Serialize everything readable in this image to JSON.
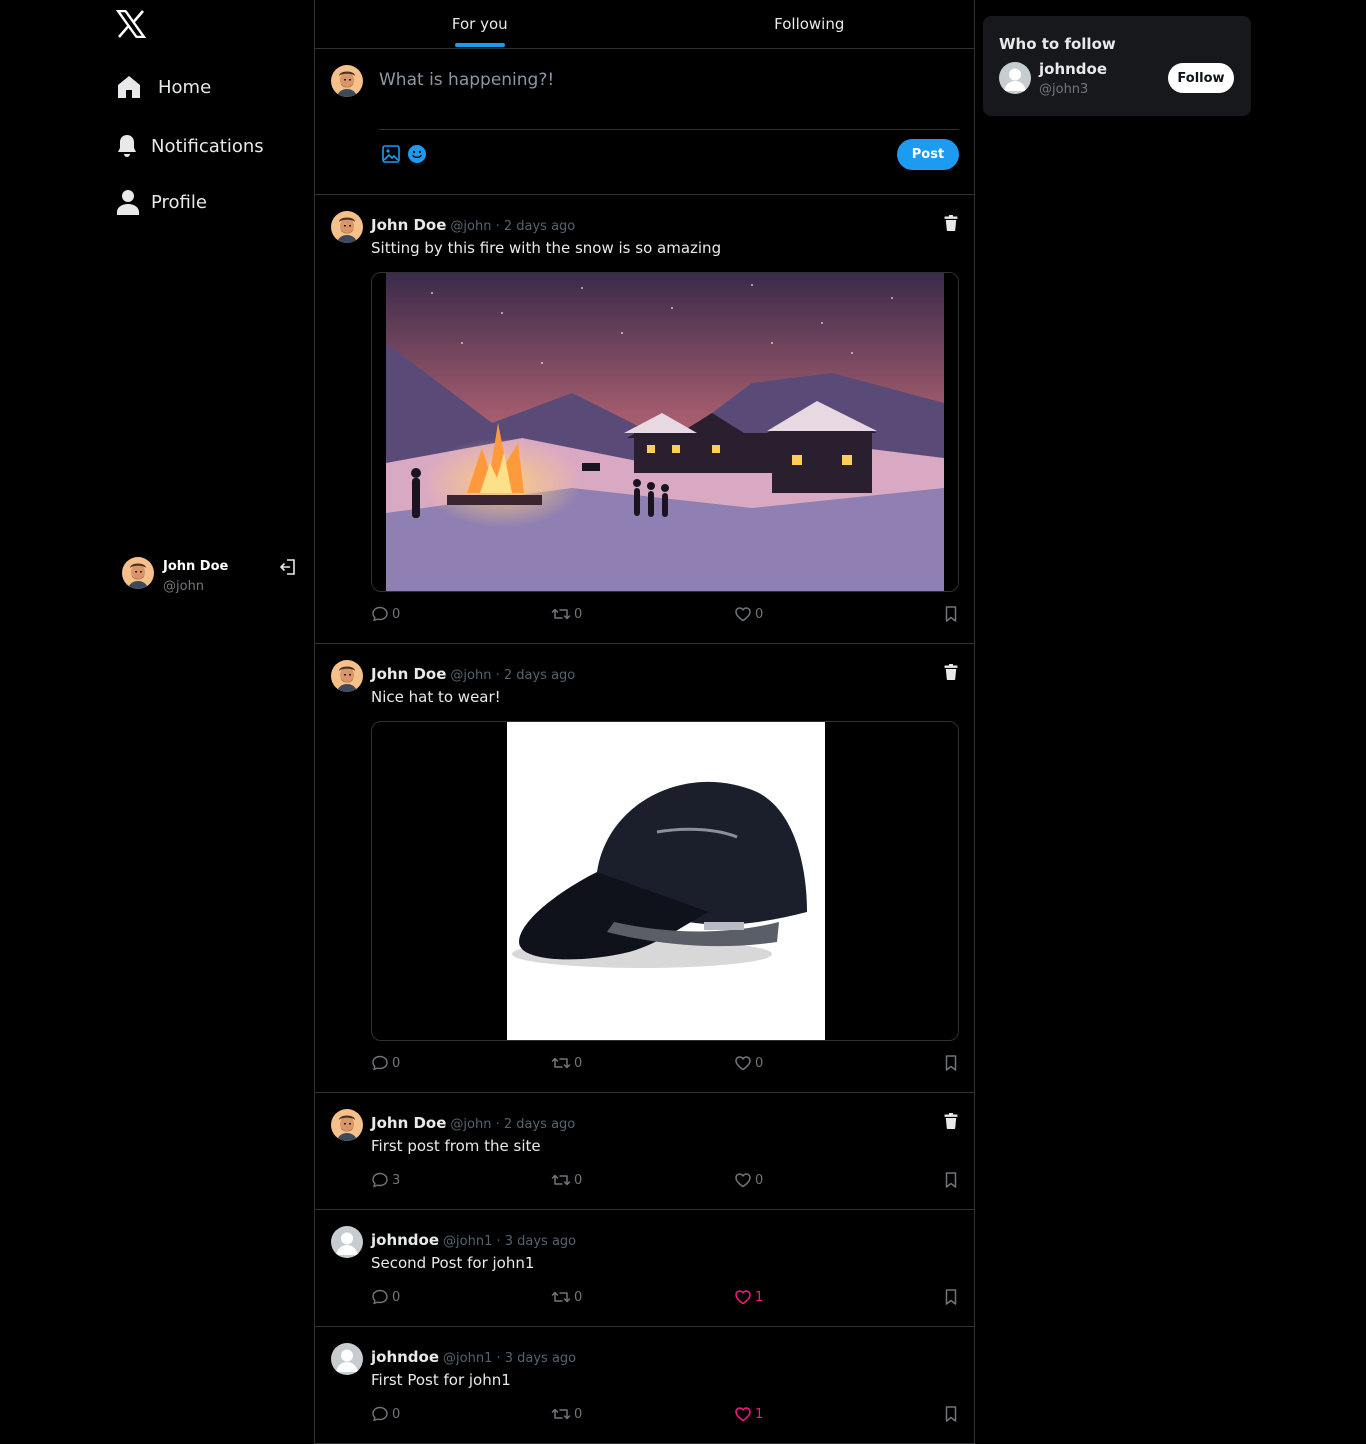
{
  "brand": {
    "logo_icon": "x-logo-icon",
    "accent": "#1d9bf0",
    "like_color": "#f91880"
  },
  "nav": {
    "items": [
      {
        "label": "Home",
        "icon": "home-icon"
      },
      {
        "label": "Notifications",
        "icon": "bell-icon"
      },
      {
        "label": "Profile",
        "icon": "user-icon"
      }
    ]
  },
  "current_user": {
    "name": "John Doe",
    "handle": "@john",
    "logout_icon": "logout-icon"
  },
  "tabs": [
    {
      "label": "For you",
      "active": true
    },
    {
      "label": "Following",
      "active": false
    }
  ],
  "composer": {
    "placeholder": "What is happening?!",
    "post_label": "Post"
  },
  "posts": [
    {
      "name": "John Doe",
      "handle": "@john",
      "time": "2 days ago",
      "meta": "@john · 2 days ago",
      "text": "Sitting by this fire with the snow is so amazing",
      "image": "winter-campfire-image",
      "comments": "0",
      "reposts": "0",
      "likes": "0",
      "liked": false,
      "deletable": true
    },
    {
      "name": "John Doe",
      "handle": "@john",
      "time": "2 days ago",
      "meta": "@john · 2 days ago",
      "text": "Nice hat to wear!",
      "image": "black-cap-image",
      "comments": "0",
      "reposts": "0",
      "likes": "0",
      "liked": false,
      "deletable": true
    },
    {
      "name": "John Doe",
      "handle": "@john",
      "time": "2 days ago",
      "meta": "@john · 2 days ago",
      "text": "First post from the site",
      "comments": "3",
      "reposts": "0",
      "likes": "0",
      "liked": false,
      "deletable": true
    },
    {
      "name": "johndoe",
      "handle": "@john1",
      "time": "3 days ago",
      "meta": "@john1 · 3 days ago",
      "text": "Second Post for john1",
      "comments": "0",
      "reposts": "0",
      "likes": "1",
      "liked": true,
      "deletable": false
    },
    {
      "name": "johndoe",
      "handle": "@john1",
      "time": "3 days ago",
      "meta": "@john1 · 3 days ago",
      "text": "First Post for john1",
      "comments": "0",
      "reposts": "0",
      "likes": "1",
      "liked": true,
      "deletable": false
    }
  ],
  "who_to_follow": {
    "title": "Who to follow",
    "users": [
      {
        "name": "johndoe",
        "handle": "@john3",
        "follow_label": "Follow"
      }
    ]
  }
}
